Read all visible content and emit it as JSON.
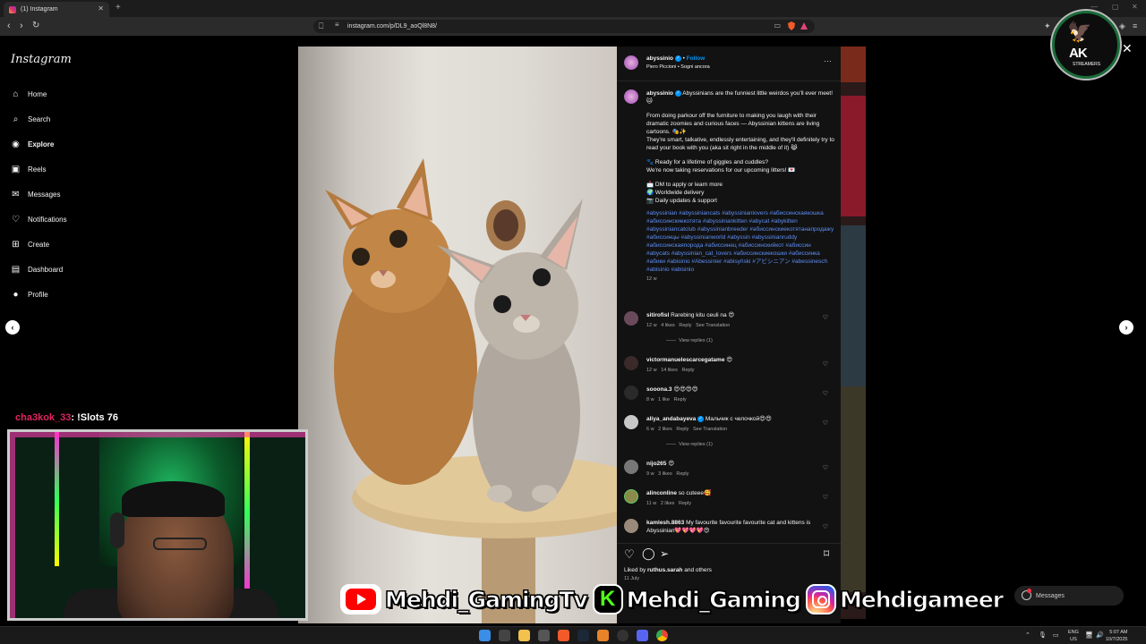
{
  "browser": {
    "tab_title": "(1) Instagram",
    "url": "instagram.com/p/DL9_aoQl8N8/"
  },
  "sidebar": {
    "logo": "Instagram",
    "items": [
      {
        "label": "Home",
        "icon": "home-icon"
      },
      {
        "label": "Search",
        "icon": "search-icon"
      },
      {
        "label": "Explore",
        "icon": "explore-icon"
      },
      {
        "label": "Reels",
        "icon": "reels-icon"
      },
      {
        "label": "Messages",
        "icon": "messages-icon"
      },
      {
        "label": "Notifications",
        "icon": "heart-icon"
      },
      {
        "label": "Create",
        "icon": "plus-square-icon"
      },
      {
        "label": "Dashboard",
        "icon": "dashboard-icon"
      },
      {
        "label": "Profile",
        "icon": "avatar"
      }
    ]
  },
  "post": {
    "author": "abyssinio",
    "follow": "Follow",
    "separator": "•",
    "audio": "Piero Piccioni • Sogni ancora",
    "caption_lines": [
      "Abyssinians are the funniest little weirdos you'll ever meet! 🐱",
      "",
      "From doing parkour off the furniture to making you laugh with their dramatic zoomies and curious faces — Abyssinian kittens are living cartoons. 🎭✨",
      "They're smart, talkative, endlessly entertaining, and they'll definitely try to read your book with you (aka sit right in the middle of it) 😹",
      "",
      "🐾 Ready for a lifetime of giggles and cuddles?",
      "We're now taking reservations for our upcoming litters! 💌",
      "",
      "📩 DM to apply or learn more",
      "🌍 Worldwide delivery",
      "📷 Daily updates & support"
    ],
    "hashtags": "#abyssinian #abyssiniancats #abyssinianlovers #абиссинскаякошка #абиссинскиекотята #abyssiniankitten #abycat #abykitten #abyssiniancatclub #abyssinianbreeder #абиссинскиекотятанапродажу #абиссинцы #abyssinianworld #abyssin #abyssinianruddy #абиссинскаяпорода #абиссинец #абиссинскийкот #абиссин #abycats #abyssinian_cat_lovers #абиссинскиекошки #абиссинка #абики #abisinio #Abessinier #abisyński #アビシニアン #abessinesch #abisinio #abisinio",
    "caption_age": "12 w",
    "liked_by_prefix": "Liked by ",
    "liked_by_user": "ruthus.sarah",
    "liked_by_suffix": " and others",
    "date": "11 July"
  },
  "comments": [
    {
      "user": "sitirofisl",
      "text": "Rarebing kitu ceuli na 😍",
      "age": "12 w",
      "likes": "4 likes",
      "reply": "Reply",
      "translate": "See Translation",
      "replies": "View replies (1)"
    },
    {
      "user": "victormanuelescarcegatame",
      "text": "😍",
      "age": "12 w",
      "likes": "14 likes",
      "reply": "Reply",
      "translate": "",
      "replies": ""
    },
    {
      "user": "sooona.3",
      "text": "😍😍😍😍",
      "age": "8 w",
      "likes": "1 like",
      "reply": "Reply",
      "translate": "",
      "replies": ""
    },
    {
      "user": "aliya_andabayeva",
      "text": "Мальчик с челочкой😍😍",
      "age": "6 w",
      "likes": "2 likes",
      "reply": "Reply",
      "translate": "See Translation",
      "replies": "View replies (1)"
    },
    {
      "user": "nijo265",
      "text": "😍",
      "age": "9 w",
      "likes": "3 likes",
      "reply": "Reply",
      "translate": "",
      "replies": ""
    },
    {
      "user": "alinconline",
      "text": "so cuteee🥰",
      "age": "11 w",
      "likes": "2 likes",
      "reply": "Reply",
      "translate": "",
      "replies": ""
    },
    {
      "user": "kamlesh.8863",
      "text": "My favourite favourite favourite cat and kittens is Abyssinian💖💖💖💖😍",
      "age": "",
      "likes": "",
      "reply": "",
      "translate": "",
      "replies": ""
    }
  ],
  "stream": {
    "chat_user": "cha3kok_33",
    "chat_text": ": !Slots 76",
    "socials": [
      {
        "platform": "youtube",
        "name": "Mehdi_GamingTv"
      },
      {
        "platform": "kick",
        "name": "Mehdi_Gaming"
      },
      {
        "platform": "instagram",
        "name": "Mehdigameer"
      }
    ],
    "badge_text": "AK",
    "badge_sub": "STREAMERS"
  },
  "messages_pill": "Messages",
  "taskbar": {
    "lang_1": "ENG",
    "lang_2": "US",
    "time": "5:07 AM",
    "date": "10/7/2025"
  },
  "colors": {
    "hashtag": "#5d8ef5",
    "verified": "#0095f6",
    "follow": "#0095f6",
    "kick_green": "#53fc18"
  }
}
